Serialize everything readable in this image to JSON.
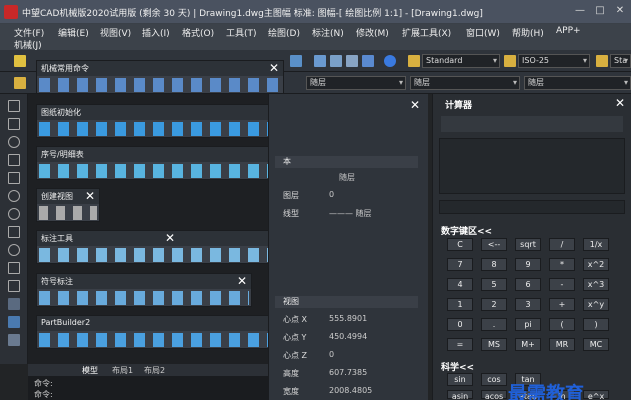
{
  "window": {
    "title": "中望CAD机械版2020试用版 (剩余 30 天) | Drawing1.dwg主图幅  标准: 图幅-[ 绘图比例 1:1] - [Drawing1.dwg]",
    "min": "—",
    "max": "□",
    "close": "✕"
  },
  "menu": [
    "文件(F)",
    "编辑(E)",
    "视图(V)",
    "插入(I)",
    "格式(O)",
    "工具(T)",
    "绘图(D)",
    "标注(N)",
    "修改(M)",
    "扩展工具(X)",
    "窗口(W)",
    "帮助(H)",
    "APP+",
    "机械(J)"
  ],
  "toolbar": {
    "text_style": "Standard",
    "dim_style": "ISO-25",
    "last_style": "Sta",
    "layer1": "随层",
    "layer2": "随层",
    "layer3": "随层"
  },
  "floating": [
    {
      "title": "机械常用命令"
    },
    {
      "title": "图纸初始化"
    },
    {
      "title": "序号/明细表"
    },
    {
      "title": "创建视图"
    },
    {
      "title": "标注工具"
    },
    {
      "title": "符号标注"
    },
    {
      "title": "PartBuilder2"
    }
  ],
  "props": {
    "section1": "本",
    "rows": [
      {
        "label": "",
        "value": "随层"
      },
      {
        "label": "图层",
        "value": "0"
      },
      {
        "label": "线型",
        "value": "——— 随层"
      }
    ],
    "section2": "视图",
    "view_rows": [
      {
        "label": "心点 X",
        "value": "555.8901"
      },
      {
        "label": "心点 Y",
        "value": "450.4994"
      },
      {
        "label": "心点 Z",
        "value": "0"
      },
      {
        "label": "高度",
        "value": "607.7385"
      },
      {
        "label": "宽度",
        "value": "2008.4805"
      }
    ]
  },
  "calc": {
    "title": "计算器",
    "keypad_label": "数字键区<<",
    "keys": [
      [
        "C",
        "<--",
        "sqrt",
        "/",
        "1/x"
      ],
      [
        "7",
        "8",
        "9",
        "*",
        "x^2"
      ],
      [
        "4",
        "5",
        "6",
        "-",
        "x^3"
      ],
      [
        "1",
        "2",
        "3",
        "+",
        "x^y"
      ],
      [
        "0",
        ".",
        "pi",
        "(",
        ")"
      ],
      [
        "=",
        "MS",
        "M+",
        "MR",
        "MC"
      ]
    ],
    "sci_label": "科学<<",
    "sci_keys": [
      "sin",
      "cos",
      "tan"
    ],
    "sci_keys2": [
      "asin",
      "acos",
      "atan",
      "ln",
      "e^x"
    ]
  },
  "tabs": [
    "模型",
    "布局1",
    "布局2"
  ],
  "command": {
    "line1": "命令:",
    "line2": "命令:"
  },
  "watermark": "最需教育"
}
